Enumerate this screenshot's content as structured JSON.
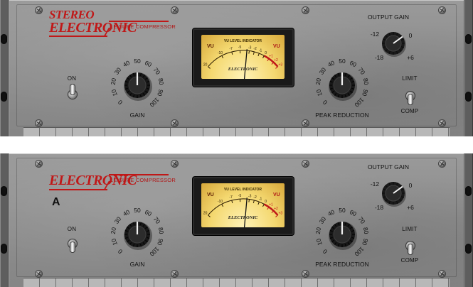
{
  "units": [
    {
      "brand_line1": "STEREO",
      "brand_line2": "ELECTRONIC",
      "tagline": "LEISURE COMPRESSOR",
      "variant": "",
      "power_label": "ON",
      "gain": {
        "label": "GAIN",
        "ticks": [
          "0",
          "10",
          "20",
          "30",
          "40",
          "50",
          "60",
          "70",
          "80",
          "90",
          "100"
        ],
        "value": 50
      },
      "peak_reduction": {
        "label": "PEAK REDUCTION",
        "ticks": [
          "0",
          "10",
          "20",
          "30",
          "40",
          "50",
          "60",
          "70",
          "80",
          "90",
          "100"
        ],
        "value": 50
      },
      "output_gain": {
        "label": "OUTPUT GAIN",
        "ticks": [
          "-18",
          "-12",
          "0",
          "+6"
        ],
        "value": 0
      },
      "mode": {
        "top_label": "LIMIT",
        "bottom_label": "COMP"
      },
      "meter": {
        "title": "VU LEVEL INDICATOR",
        "vu_left": "VU",
        "vu_right": "VU",
        "brand": "ELECTRONIC",
        "scale": [
          "20",
          "-10",
          "-7",
          "-5",
          "-3",
          "-2",
          "-1",
          "0",
          "+1",
          "+2",
          "+3"
        ],
        "needle_db": -3.5
      }
    },
    {
      "brand_line1": "",
      "brand_line2": "ELECTRONIC",
      "tagline": "LEISURE COMPRESSOR",
      "variant": "A",
      "power_label": "ON",
      "gain": {
        "label": "GAIN",
        "ticks": [
          "0",
          "10",
          "20",
          "30",
          "40",
          "50",
          "60",
          "70",
          "80",
          "90",
          "100"
        ],
        "value": 50
      },
      "peak_reduction": {
        "label": "PEAK REDUCTION",
        "ticks": [
          "0",
          "10",
          "20",
          "30",
          "40",
          "50",
          "60",
          "70",
          "80",
          "90",
          "100"
        ],
        "value": 50
      },
      "output_gain": {
        "label": "OUTPUT GAIN",
        "ticks": [
          "-18",
          "-12",
          "0",
          "+6"
        ],
        "value": 0
      },
      "mode": {
        "top_label": "LIMIT",
        "bottom_label": "COMP"
      },
      "meter": {
        "title": "VU LEVEL INDICATOR",
        "vu_left": "VU",
        "vu_right": "VU",
        "brand": "ELECTRONIC",
        "scale": [
          "20",
          "-10",
          "-7",
          "-5",
          "-3",
          "-2",
          "-1",
          "0",
          "+1",
          "+2",
          "+3"
        ],
        "needle_db": -3.5
      }
    }
  ],
  "colors": {
    "brand_red": "#c01818",
    "panel_gray": "#8e8e8e",
    "meter_amber": "#f4d870",
    "needle": "#111111"
  }
}
